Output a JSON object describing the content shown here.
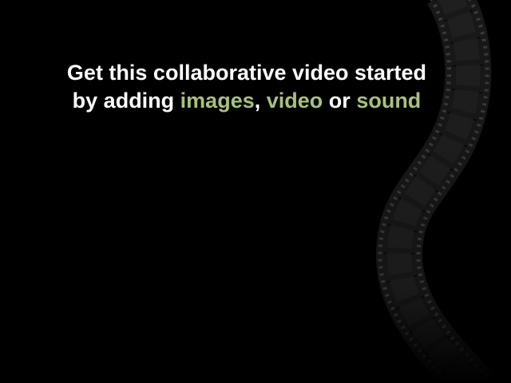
{
  "prompt": {
    "line1": "Get this collaborative video started",
    "line2_prefix": "by adding ",
    "images_link": "images",
    "comma": ",",
    "space": " ",
    "video_link": "video",
    "or_word": " or ",
    "sound_link": "sound"
  },
  "colors": {
    "background": "#000000",
    "text": "#ffffff",
    "accent": "#a7c27a",
    "filmstrip": "#1c1c1c"
  },
  "decoration": {
    "icon": "film-strip-icon"
  }
}
